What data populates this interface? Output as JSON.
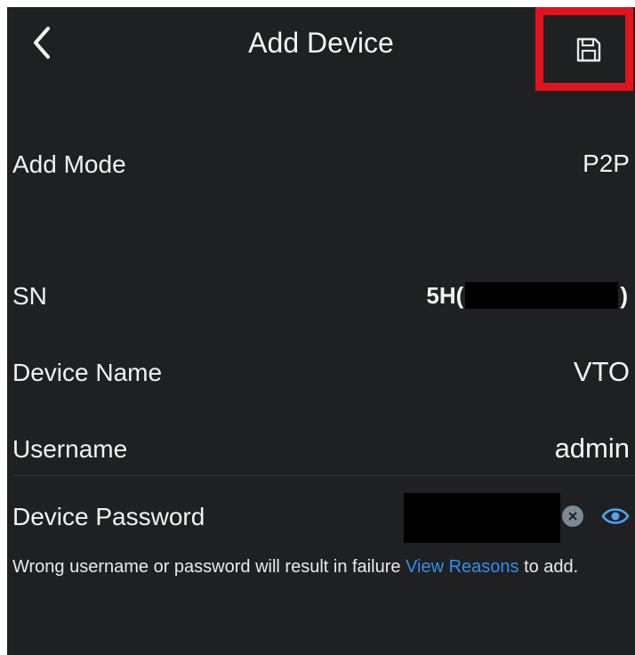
{
  "header": {
    "title": "Add Device",
    "back_icon": "chevron-left-icon",
    "save_icon": "floppy-disk-icon",
    "highlight_color": "#e0141e"
  },
  "form": {
    "add_mode": {
      "label": "Add Mode",
      "value": "P2P"
    },
    "sn": {
      "label": "SN",
      "value_prefix": "5H(",
      "value_suffix": ")"
    },
    "device_name": {
      "label": "Device Name",
      "value": "VTO"
    },
    "username": {
      "label": "Username",
      "value": "admin"
    },
    "password": {
      "label": "Device Password",
      "clear_icon": "clear-icon",
      "visibility_icon": "eye-icon"
    }
  },
  "note": {
    "text_before": "Wrong username or password will result in failure ",
    "link": "View Reasons",
    "text_after": " to add."
  },
  "colors": {
    "background": "#1e2022",
    "text": "#f2f2f2",
    "link": "#2f8ff0"
  }
}
